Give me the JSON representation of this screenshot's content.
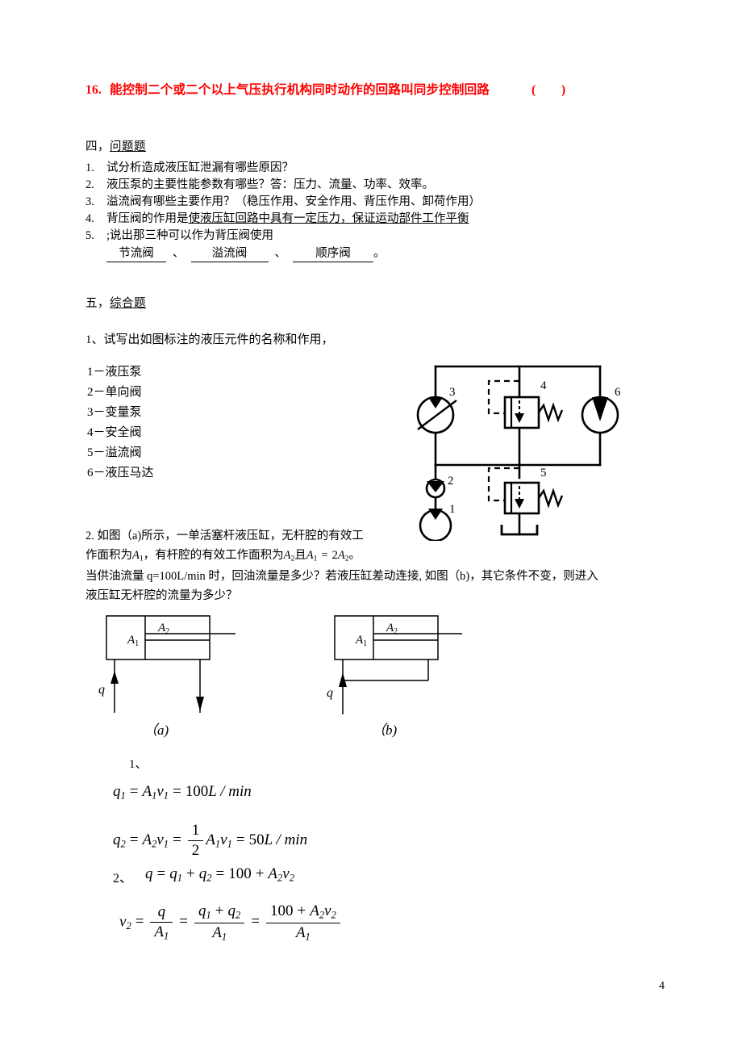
{
  "page": {
    "number": "4",
    "accent_red": "#ff0000"
  },
  "question16": {
    "number": "16.",
    "text": "能控制二个或二个以上气压执行机构同时动作的回路叫同步控制回路",
    "answer_box": "(    )"
  },
  "section4": {
    "heading_prefix": "四，",
    "heading_title": "问题题",
    "items": [
      {
        "n": "1.",
        "text": "试分析造成液压缸泄漏有哪些原因？"
      },
      {
        "n": "2.",
        "text": "液压泵的主要性能参数有哪些？答：压力、流量、功率、效率。"
      },
      {
        "n": "3.",
        "text": "溢流阀有哪些主要作用？（稳压作用、安全作用、背压作用、卸荷作用）"
      },
      {
        "n": "4.",
        "prefix": "背压阀的作用是",
        "underlined": "使液压缸回路中具有一定压力，保证运动部件工作平衡"
      },
      {
        "n": "5.",
        "text": ";说出那三种可以作为背压阀使用"
      }
    ],
    "blanks": {
      "blank1": "节流阀",
      "sep1": "、",
      "blank2": "溢流阀",
      "sep2": "、",
      "blank3": "顺序阀",
      "period": "。"
    }
  },
  "section5": {
    "heading_prefix": "五，",
    "heading_title": "综合题",
    "problem1": {
      "text": "1、试写出如图标注的液压元件的名称和作用，",
      "components": [
        "1－液压泵",
        "2－单向阀",
        "3－变量泵",
        "4－安全阀",
        "5－溢流阀",
        "6－液压马达"
      ]
    },
    "circuit": {
      "labels": [
        "1",
        "2",
        "3",
        "4",
        "5",
        "6"
      ]
    },
    "problem2": {
      "line1": "2. 如图（a)所示，一单活塞杆液压缸，无杆腔的有效工",
      "line2_a": "作面积为",
      "line2_A1": "A",
      "line2_A1sub": "1",
      "line2_b": "，有杆腔的有效工作面积为",
      "line2_A2": "A",
      "line2_A2sub": "2",
      "line2_c": "且",
      "line2_d": "A",
      "line2_dsub": "1",
      "line2_eq": "=",
      "line2_two": "2",
      "line2_A2b": "A",
      "line2_A2bsub": "2",
      "line2_end": "。",
      "line3": "当供油流量 q=100L/min 时，回油流量是多少？若液压缸差动连接, 如图（b)，其它条件不变，则进入",
      "line4": "液压缸无杆腔的流量为多少？"
    },
    "figures": {
      "a": {
        "caption": "（a)",
        "A1": "A",
        "A1sub": "1",
        "A2": "A",
        "A2sub": "2",
        "q": "q"
      },
      "b": {
        "caption": "（b)",
        "A1": "A",
        "A1sub": "1",
        "A2": "A",
        "A2sub": "2",
        "q": "q"
      }
    },
    "solution": {
      "step1_label": "1、",
      "eq1": {
        "lhs": "q",
        "lhs_sub": "1",
        "t1_A": "A",
        "t1_Asub": "1",
        "t1_v": "v",
        "t1_vsub": "1",
        "result_num": "100",
        "result_unit": "L / min"
      },
      "eq2": {
        "lhs": "q",
        "lhs_sub": "2",
        "t1_A": "A",
        "t1_Asub": "2",
        "t1_v": "v",
        "t1_vsub": "1",
        "frac_top": "1",
        "frac_bot": "2",
        "t2_A": "A",
        "t2_Asub": "1",
        "t2_v": "v",
        "t2_vsub": "1",
        "result_num": "50",
        "result_unit": "L / min"
      },
      "step2_label": "2、",
      "eq3": {
        "q": "q",
        "q1": "q",
        "q1sub": "1",
        "q2": "q",
        "q2sub": "2",
        "num": "100",
        "A2": "A",
        "A2sub": "2",
        "v2": "v",
        "v2sub": "2"
      },
      "eq4": {
        "lhs": "v",
        "lhs_sub": "2",
        "f1_top_q": "q",
        "f1_bot_A": "A",
        "f1_bot_Asub": "1",
        "f2_top_q1": "q",
        "f2_top_q1sub": "1",
        "f2_top_q2": "q",
        "f2_top_q2sub": "2",
        "f2_bot_A": "A",
        "f2_bot_Asub": "1",
        "f3_top_num": "100",
        "f3_top_A2": "A",
        "f3_top_A2sub": "2",
        "f3_top_v2": "v",
        "f3_top_v2sub": "2",
        "f3_bot_A": "A",
        "f3_bot_Asub": "1"
      }
    }
  }
}
